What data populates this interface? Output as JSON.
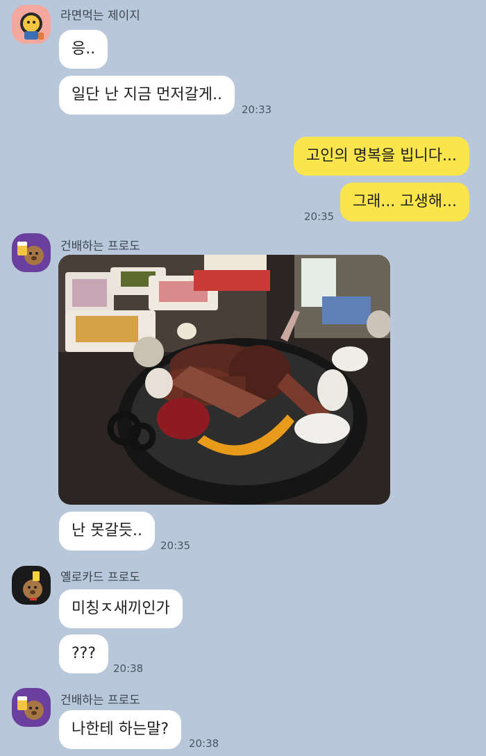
{
  "messages": {
    "jay_name": "라면먹는 제이지",
    "m1": "응..",
    "m2": "일단 난 지금 먼저갈게..",
    "t1": "20:33",
    "out1": "고인의 명복을 빕니다...",
    "out2": "그래... 고생해...",
    "t2": "20:35",
    "frodo_name": "건배하는 프로도",
    "m3": "난 못갈듯..",
    "t3": "20:35",
    "yellow_name": "옐로카드 프로도",
    "m4": "미칭ㅈ새끼인가",
    "m5": "???",
    "t4": "20:38",
    "frodo_name2": "건배하는 프로도",
    "m6": "나한테 하는말?",
    "t5": "20:38"
  },
  "colors": {
    "background": "#b8c7d9",
    "incoming_bubble": "#ffffff",
    "outgoing_bubble": "#fae64c"
  },
  "icons": {
    "avatar1": "ryan-eating-ramen-icon",
    "avatar2": "frodo-cheers-icon",
    "avatar3": "frodo-yellow-card-icon",
    "photo": "grilled-meat-photo"
  }
}
